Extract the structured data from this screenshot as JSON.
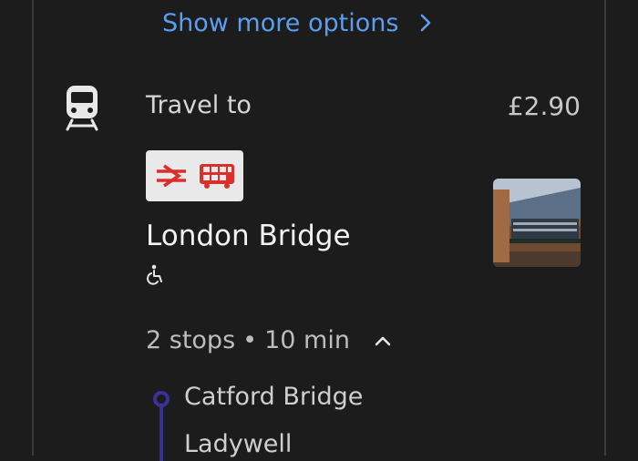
{
  "options": {
    "show_more_label": "Show more options"
  },
  "leg": {
    "travel_label": "Travel to",
    "price": "£2.90",
    "station": "London Bridge",
    "stops_count": "2 stops",
    "separator": "•",
    "duration": "10 min",
    "stops": [
      {
        "name": "Catford Bridge"
      },
      {
        "name": "Ladywell"
      }
    ],
    "line_color": "#3d2f98",
    "icons": [
      "chevron-right-icon",
      "train-icon",
      "national-rail-icon",
      "bus-icon",
      "wheelchair-accessible-icon",
      "chevron-up-icon"
    ]
  },
  "colors": {
    "link": "#5b9ef0",
    "background": "#1c1c1c",
    "rail_red": "#d9302b"
  }
}
